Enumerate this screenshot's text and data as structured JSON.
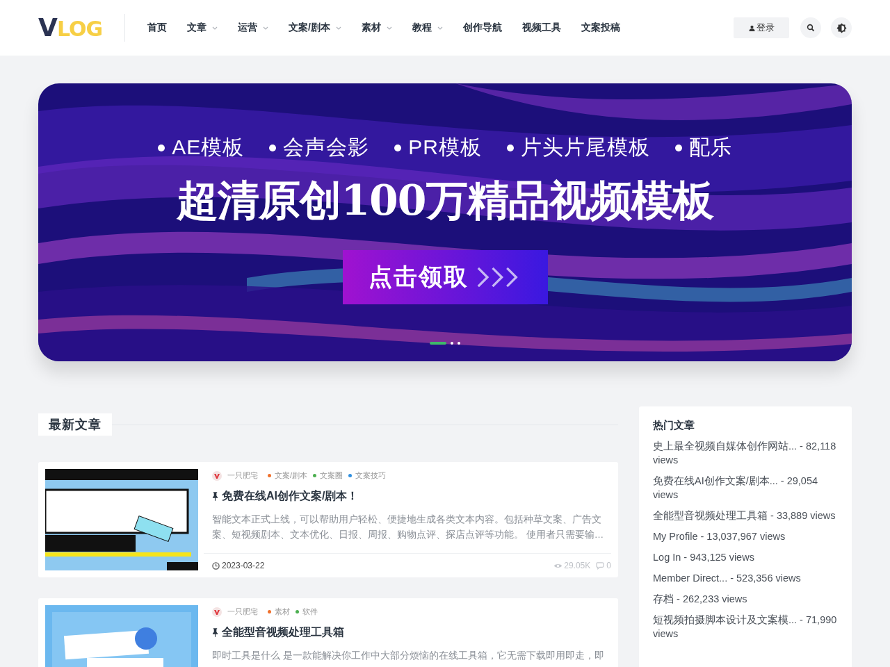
{
  "header": {
    "logo": {
      "letter": "V",
      "word": "LOG"
    },
    "nav": [
      {
        "label": "首页",
        "dropdown": false
      },
      {
        "label": "文章",
        "dropdown": true
      },
      {
        "label": "运营",
        "dropdown": true
      },
      {
        "label": "文案/剧本",
        "dropdown": true
      },
      {
        "label": "素材",
        "dropdown": true
      },
      {
        "label": "教程",
        "dropdown": true
      },
      {
        "label": "创作导航",
        "dropdown": false
      },
      {
        "label": "视频工具",
        "dropdown": false
      },
      {
        "label": "文案投稿",
        "dropdown": false
      }
    ],
    "login": "登录"
  },
  "banner": {
    "tags": [
      "AE模板",
      "会声会影",
      "PR模板",
      "片头片尾模板",
      "配乐"
    ],
    "headline": "超清原创100万精品视频模板",
    "cta": "点击领取",
    "dots": [
      {
        "selected": true
      },
      {
        "selected": false
      },
      {
        "selected": false
      }
    ]
  },
  "section_title": "最新文章",
  "articles": [
    {
      "author": "一只肥宅",
      "tags": [
        {
          "label": "文案/剧本",
          "color": "#f0712c"
        },
        {
          "label": "文案圈",
          "color": "#4caf50"
        },
        {
          "label": "文案技巧",
          "color": "#2f8fe0"
        }
      ],
      "title": "免费在线AI创作文案/剧本！",
      "excerpt": "智能文本正式上线，可以帮助用户轻松、便捷地生成各类文本内容。包括种草文案、广告文案、短视频剧本、文本优化、日报、周报、购物点评、探店点评等功能。 使用者只需要输…",
      "date": "2023-03-22",
      "views": "29.05K",
      "comments": "0"
    },
    {
      "author": "一只肥宅",
      "tags": [
        {
          "label": "素材",
          "color": "#f0712c"
        },
        {
          "label": "软件",
          "color": "#4caf50"
        }
      ],
      "title": "全能型音视频处理工具箱",
      "excerpt": "即时工具是什么 是一款能解决你工作中大部分烦恼的在线工具箱，它无需下载即用即走，即"
    }
  ],
  "sidebar": {
    "title": "热门文章",
    "items": [
      "史上最全视频自媒体创作网站... - 82,118 views",
      "免费在线AI创作文案/剧本... - 29,054 views",
      "全能型音视频处理工具箱 - 33,889 views",
      "My Profile - 13,037,967 views",
      "Log In - 943,125 views",
      "Member Direct... - 523,356 views",
      "存档 - 262,233 views",
      "短视频拍摄脚本设计及文案模... - 71,990 views"
    ]
  }
}
